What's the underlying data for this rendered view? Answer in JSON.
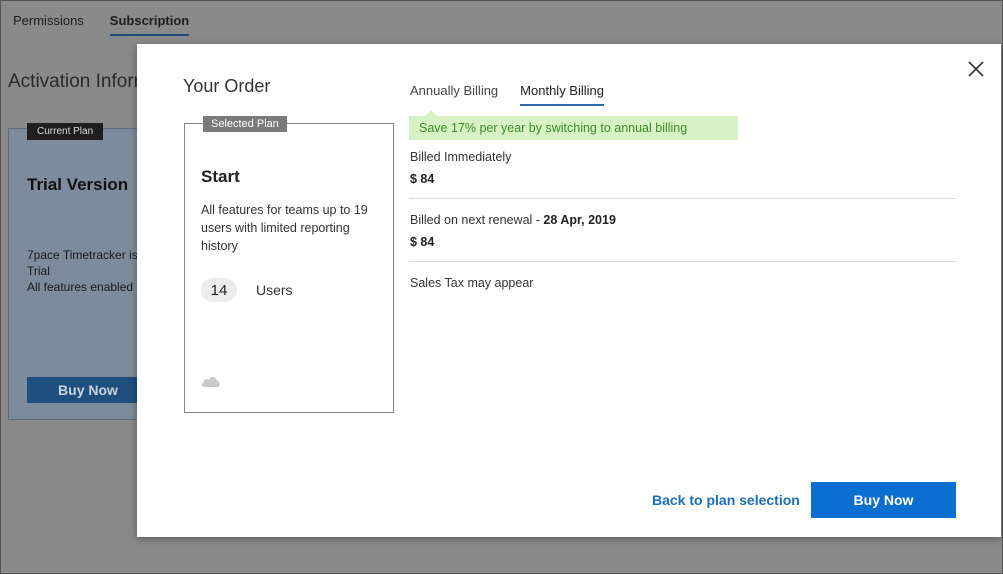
{
  "background": {
    "tabs": [
      {
        "label": "Permissions",
        "active": false
      },
      {
        "label": "Subscription",
        "active": true
      }
    ],
    "heading": "Activation Inform",
    "card": {
      "badge": "Current Plan",
      "title": "Trial Version",
      "desc_line1": "7pace Timetracker is",
      "desc_line2": "Trial",
      "desc_line3": "All features enabled",
      "buy_label": "Buy Now"
    }
  },
  "modal": {
    "title": "Your Order",
    "plan": {
      "badge": "Selected Plan",
      "name": "Start",
      "description": "All features for teams up to 19 users with limited reporting history",
      "users_count": "14",
      "users_label": "Users",
      "icon": "cloud-icon"
    },
    "billing_tabs": [
      {
        "label": "Annually Billing",
        "active": false
      },
      {
        "label": "Monthly Billing",
        "active": true
      }
    ],
    "savings_note": "Save 17% per year by switching to annual billing",
    "billed_immediately": {
      "label": "Billed Immediately",
      "amount": "$ 84"
    },
    "billed_next": {
      "label": "Billed on next renewal - ",
      "date": "28 Apr, 2019",
      "amount": "$ 84"
    },
    "tax_note": "Sales Tax may appear",
    "back_label": "Back to plan selection",
    "buy_label": "Buy Now",
    "colors": {
      "accent": "#0a6fd1",
      "link": "#1a6fb8",
      "savings_bg": "#d7f3c6",
      "savings_text": "#3f8a2a"
    }
  }
}
